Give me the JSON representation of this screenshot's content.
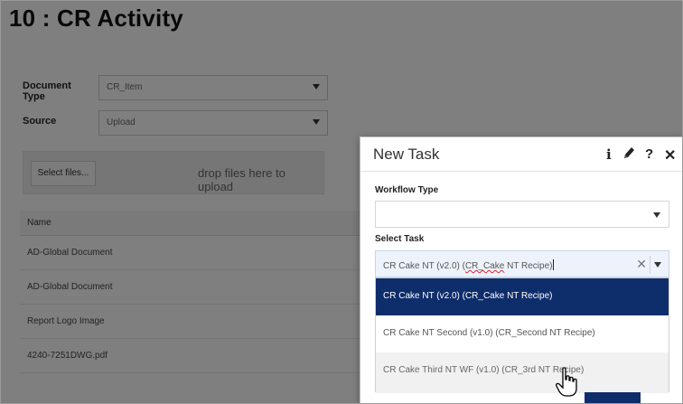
{
  "page": {
    "title": "10 : CR Activity",
    "document_type": {
      "label": "Document Type",
      "value": "CR_Item"
    },
    "source": {
      "label": "Source",
      "value": "Upload"
    },
    "upload": {
      "button_label": "Select files...",
      "drop_text": "drop files here to upload"
    },
    "table": {
      "header": "Name",
      "rows": [
        "AD-Global Document",
        "AD-Global Document",
        "Report Logo Image",
        "4240-7251DWG.pdf"
      ]
    }
  },
  "modal": {
    "title": "New Task",
    "icons": [
      "info-icon",
      "edit-icon",
      "help-icon",
      "close-icon"
    ],
    "header_glyphs": {
      "info": "i",
      "edit": "✎",
      "help": "?",
      "close": "✕"
    },
    "workflow_type": {
      "label": "Workflow Type",
      "value": ""
    },
    "select_task": {
      "label": "Select Task",
      "value_prefix": "CR Cake NT (v2.0) (",
      "value_spell": "CR_Cake",
      "value_suffix": " NT Recipe)",
      "clear_glyph": "✕",
      "options": [
        "CR Cake NT (v2.0) (CR_Cake NT Recipe)",
        "CR Cake NT Second (v1.0) (CR_Second NT Recipe)",
        "CR Cake Third NT WF (v1.0) (CR_3rd NT Recipe)"
      ],
      "selected_index": 0
    }
  },
  "colors": {
    "selected_option_bg": "#0e2d6b",
    "overlay": "rgba(0,0,0,0.5)"
  }
}
